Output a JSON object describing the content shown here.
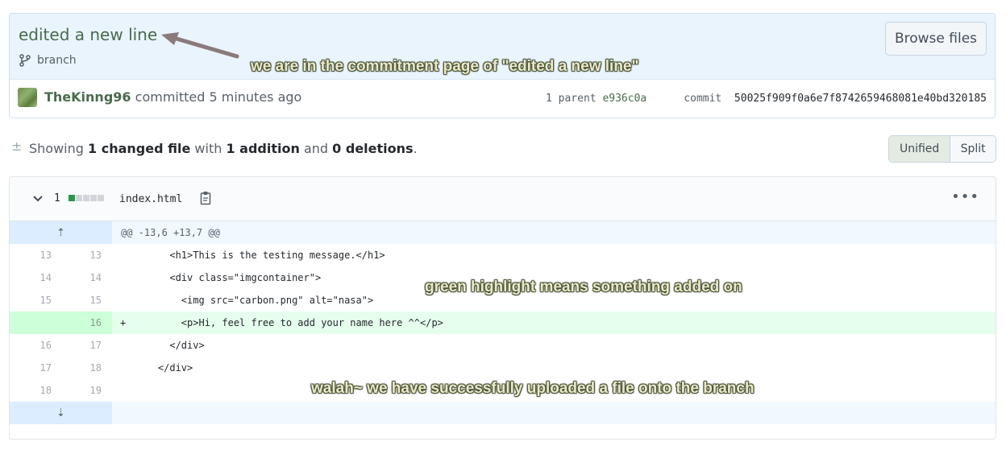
{
  "commit": {
    "title": "edited a new line",
    "branch": "branch",
    "browse_label": "Browse files",
    "author": "TheKinng96",
    "committed_text": "committed 5 minutes ago",
    "parent_label": "1 parent",
    "parent_sha": "e936c0a",
    "commit_label": "commit",
    "commit_sha": "50025f909f0a6e7f8742659468081e40bd320185"
  },
  "summary": {
    "showing": "Showing",
    "changed": "1 changed file",
    "with": "with",
    "additions": "1 addition",
    "and": "and",
    "deletions": "0 deletions",
    "period": "."
  },
  "view_toggle": {
    "unified": "Unified",
    "split": "Split",
    "selected": "Unified"
  },
  "file": {
    "diffstat_count": "1",
    "diffstat_blocks": [
      "added",
      "neutral",
      "neutral",
      "neutral",
      "neutral"
    ],
    "name": "index.html",
    "hunk_header": "@@ -13,6 +13,7 @@",
    "lines": [
      {
        "old": "13",
        "new": "13",
        "sign": "",
        "code": "      <h1>This is the testing message.</h1>",
        "type": "context"
      },
      {
        "old": "14",
        "new": "14",
        "sign": "",
        "code": "      <div class=\"imgcontainer\">",
        "type": "context"
      },
      {
        "old": "15",
        "new": "15",
        "sign": "",
        "code": "        <img src=\"carbon.png\" alt=\"nasa\">",
        "type": "context"
      },
      {
        "old": "",
        "new": "16",
        "sign": "+",
        "code": "        <p>Hi, feel free to add your name here ^^</p>",
        "type": "added"
      },
      {
        "old": "16",
        "new": "17",
        "sign": "",
        "code": "      </div>",
        "type": "context"
      },
      {
        "old": "17",
        "new": "18",
        "sign": "",
        "code": "    </div>",
        "type": "context"
      },
      {
        "old": "18",
        "new": "19",
        "sign": "",
        "code": "",
        "type": "context"
      }
    ]
  },
  "annotations": {
    "commit_page": "we are in the commitment page of \"edited a new line\"",
    "green_highlight": "green highlight means something added on",
    "success": "walah~ we have successfully uploaded a file onto the branch"
  },
  "colors": {
    "accent_green": "#4a6b4c",
    "added_bg": "#e6ffed",
    "hunk_bg": "#f1f8ff",
    "commit_header_bg": "#eaf4fd"
  }
}
